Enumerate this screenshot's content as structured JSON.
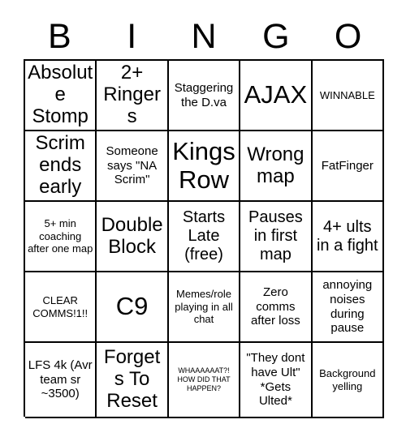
{
  "card": {
    "header_letters": [
      "B",
      "I",
      "N",
      "G",
      "O"
    ],
    "columns": 5,
    "rows": 5,
    "colors": {
      "background": "#ffffff",
      "text": "#000000",
      "grid_line": "#000000"
    },
    "cells": [
      [
        {
          "text": "Absolute Stomp",
          "size": "lg"
        },
        {
          "text": "2+ Ringers",
          "size": "lg"
        },
        {
          "text": "Staggering the D.va",
          "size": "sm"
        },
        {
          "text": "AJAX",
          "size": "xl"
        },
        {
          "text": "WINNABLE",
          "size": "xs"
        }
      ],
      [
        {
          "text": "Scrim ends early",
          "size": "lg"
        },
        {
          "text": "Someone says \"NA Scrim\"",
          "size": "sm"
        },
        {
          "text": "Kings Row",
          "size": "xl"
        },
        {
          "text": "Wrong map",
          "size": "lg"
        },
        {
          "text": "FatFinger",
          "size": "sm"
        }
      ],
      [
        {
          "text": "5+ min coaching after one map",
          "size": "xs"
        },
        {
          "text": "Double Block",
          "size": "lg"
        },
        {
          "text": "Starts Late (free)",
          "size": "md"
        },
        {
          "text": "Pauses in first map",
          "size": "md"
        },
        {
          "text": "4+ ults in a fight",
          "size": "md"
        }
      ],
      [
        {
          "text": "CLEAR COMMS!1!!",
          "size": "xs"
        },
        {
          "text": "C9",
          "size": "xl"
        },
        {
          "text": "Memes/role playing in all chat",
          "size": "xs"
        },
        {
          "text": "Zero comms after loss",
          "size": "sm"
        },
        {
          "text": "annoying noises during pause",
          "size": "sm"
        }
      ],
      [
        {
          "text": "LFS 4k (Avr team sr ~3500)",
          "size": "sm"
        },
        {
          "text": "Forgets To Reset",
          "size": "lg"
        },
        {
          "text": "WHAAAAAAT?! HOW DID THAT HAPPEN?",
          "size": "xxs"
        },
        {
          "text": "\"They dont have Ult\" *Gets Ulted*",
          "size": "sm"
        },
        {
          "text": "Background yelling",
          "size": "xs"
        }
      ]
    ]
  }
}
